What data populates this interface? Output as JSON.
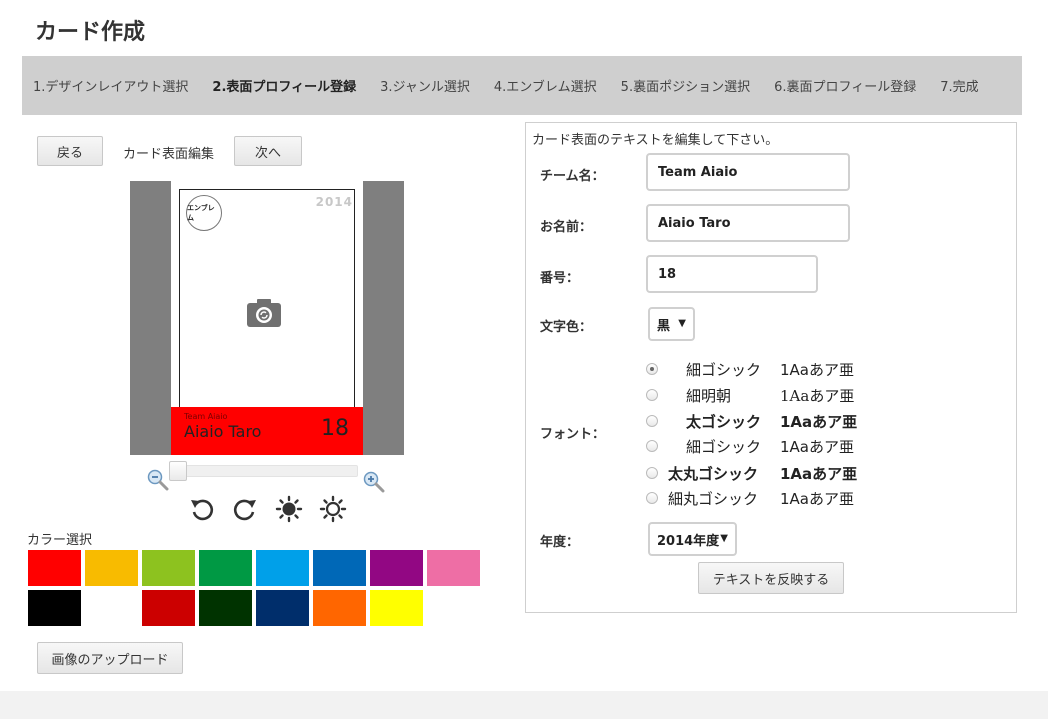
{
  "page": {
    "title": "カード作成"
  },
  "steps": [
    {
      "label": "1.デザインレイアウト選択",
      "active": false
    },
    {
      "label": "2.表面プロフィール登録",
      "active": true
    },
    {
      "label": "3.ジャンル選択",
      "active": false
    },
    {
      "label": "4.エンブレム選択",
      "active": false
    },
    {
      "label": "5.裏面ポジション選択",
      "active": false
    },
    {
      "label": "6.裏面プロフィール登録",
      "active": false
    },
    {
      "label": "7.完成",
      "active": false
    }
  ],
  "editor": {
    "back_label": "戻る",
    "mode_label": "カード表面編集",
    "next_label": "次へ",
    "upload_label": "画像のアップロード"
  },
  "card": {
    "emblem_text": "エンブレム",
    "year": "2014",
    "band_color": "#ff0000",
    "team_name": "Team Aiaio",
    "player_name": "Aiaio Taro",
    "number": "18",
    "photo_icon": "camera-icon"
  },
  "zoom": {
    "level": 0
  },
  "colors": {
    "label": "カラー選択",
    "swatches": [
      "#ff0000",
      "#f8bb00",
      "#8dc21f",
      "#009944",
      "#00a0e9",
      "#0068b7",
      "#920783",
      "#ee6ea5",
      "#000000",
      "#ffffff",
      "#cc0000",
      "#003300",
      "#002e6b",
      "#ff6600",
      "#ffff00"
    ]
  },
  "form": {
    "header": "カード表面のテキストを編集して下さい。",
    "team_label": "チーム名：",
    "team_value": "Team Aiaio",
    "name_label": "お名前：",
    "name_value": "Aiaio Taro",
    "number_label": "番号：",
    "number_value": "18",
    "color_label": "文字色：",
    "color_value": "黒",
    "font_label": "フォント：",
    "fonts": [
      {
        "name": "細ゴシック",
        "sample": "1Aaあア亜",
        "checked": true
      },
      {
        "name": "細明朝",
        "sample": "1Aaあア亜",
        "checked": false
      },
      {
        "name": "太ゴシック",
        "sample": "1Aaあア亜",
        "checked": false
      },
      {
        "name": "細ゴシック",
        "sample": "1Aaあア亜",
        "checked": false
      },
      {
        "name": "太丸ゴシック",
        "sample": "1Aaあア亜",
        "checked": false
      },
      {
        "name": "細丸ゴシック",
        "sample": "1Aaあア亜",
        "checked": false
      }
    ],
    "year_label": "年度：",
    "year_value": "2014年度",
    "apply_label": "テキストを反映する"
  }
}
